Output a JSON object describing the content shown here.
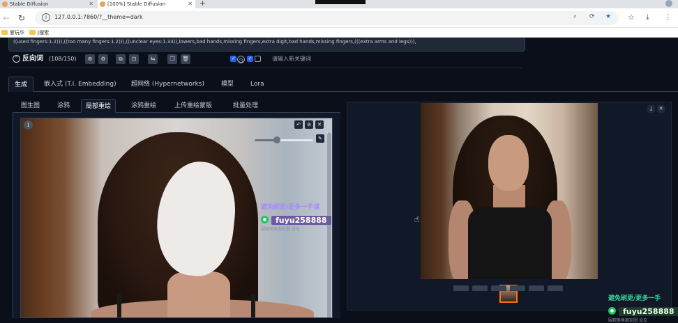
{
  "browser": {
    "tabs": [
      {
        "title": "Stable Diffusion"
      },
      {
        "title": "[100%] Stable Diffusion"
      }
    ],
    "url": "127.0.0.1:7860/?__theme=dark",
    "bookmarks": [
      "爱玩华",
      "J搜索"
    ]
  },
  "prompt": {
    "text": "((used fingers:1.2))),((too many fingers:1.2))),((unclear eyes:1.33)),lowers,bad hands,missing fingers,extra digit,bad hands,missing fingers,(((extra arms and legs))),"
  },
  "negative": {
    "title": "反向词",
    "count": "(108/150)",
    "keyword_placeholder": "请输入新关键词"
  },
  "main_tabs": [
    "生成",
    "嵌入式 (T.I. Embedding)",
    "超网络 (Hypernetworks)",
    "模型",
    "Lora"
  ],
  "sub_tabs": [
    "图生图",
    "涂鸦",
    "局部重绘",
    "涂鸦重绘",
    "上传重绘蒙版",
    "批量处理"
  ],
  "brush_slider": {
    "value": 0.38
  },
  "watermark": {
    "line1": "避免刷更/更多一手课",
    "wechat_id": "fuyu258888",
    "line3": "围观美鱼朋友圈 设见"
  },
  "watermark2": {
    "line1": "避免刷更/更多一手",
    "wechat_id": "fuyu258888",
    "line3": "围观美鱼朋友圈 设见"
  },
  "colors": {
    "accent": "#2563eb",
    "thumb_border": "#f97316",
    "background": "#0b0f19"
  }
}
